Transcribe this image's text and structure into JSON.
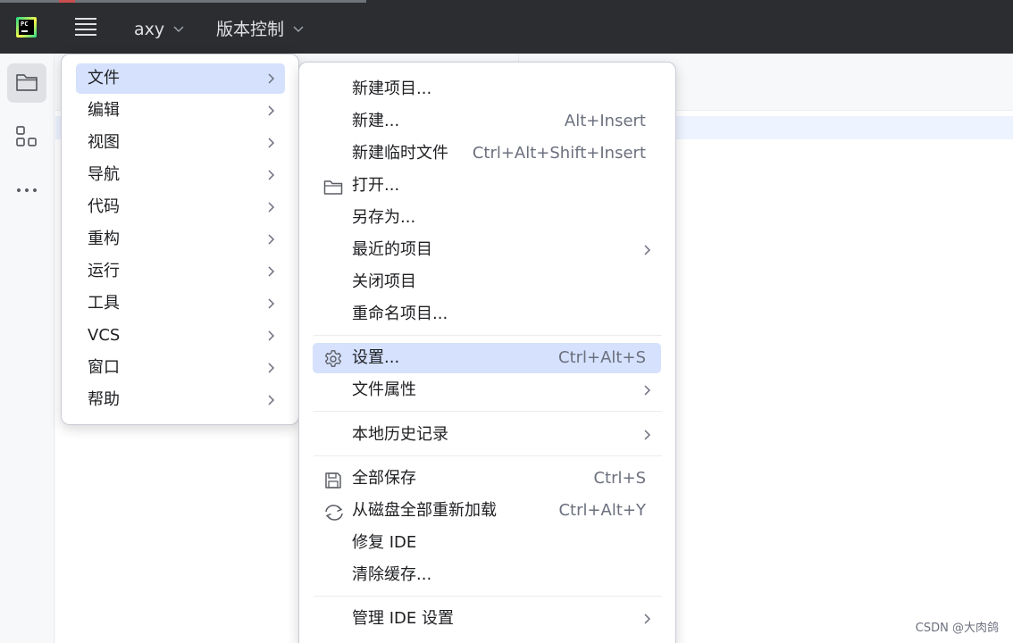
{
  "titlebar": {
    "project": "axy",
    "vcs": "版本控制"
  },
  "main_menu": {
    "items": [
      {
        "label": "文件"
      },
      {
        "label": "编辑"
      },
      {
        "label": "视图"
      },
      {
        "label": "导航"
      },
      {
        "label": "代码"
      },
      {
        "label": "重构"
      },
      {
        "label": "运行"
      },
      {
        "label": "工具"
      },
      {
        "label": "VCS"
      },
      {
        "label": "窗口"
      },
      {
        "label": "帮助"
      }
    ]
  },
  "file_menu": {
    "items": [
      {
        "label": "新建项目...",
        "shortcut": ""
      },
      {
        "label": "新建...",
        "shortcut": "Alt+Insert"
      },
      {
        "label": "新建临时文件",
        "shortcut": "Ctrl+Alt+Shift+Insert"
      },
      {
        "label": "打开...",
        "shortcut": "",
        "icon": "folder-icon"
      },
      {
        "label": "另存为...",
        "shortcut": ""
      },
      {
        "label": "最近的项目",
        "shortcut": ""
      },
      {
        "label": "关闭项目",
        "shortcut": ""
      },
      {
        "label": "重命名项目...",
        "shortcut": ""
      },
      {
        "label": "设置...",
        "shortcut": "Ctrl+Alt+S",
        "icon": "gear-icon"
      },
      {
        "label": "文件属性",
        "shortcut": ""
      },
      {
        "label": "本地历史记录",
        "shortcut": ""
      },
      {
        "label": "全部保存",
        "shortcut": "Ctrl+S",
        "icon": "save-icon"
      },
      {
        "label": "从磁盘全部重新加载",
        "shortcut": "Ctrl+Alt+Y",
        "icon": "reload-icon"
      },
      {
        "label": "修复 IDE",
        "shortcut": ""
      },
      {
        "label": "清除缓存...",
        "shortcut": ""
      },
      {
        "label": "管理 IDE 设置",
        "shortcut": ""
      }
    ]
  },
  "watermark": "CSDN @大肉鸽",
  "colors": {
    "titlebar_bg": "#2b2d30",
    "highlight": "#d5e1fd",
    "shortcut_text": "#6c707e"
  }
}
